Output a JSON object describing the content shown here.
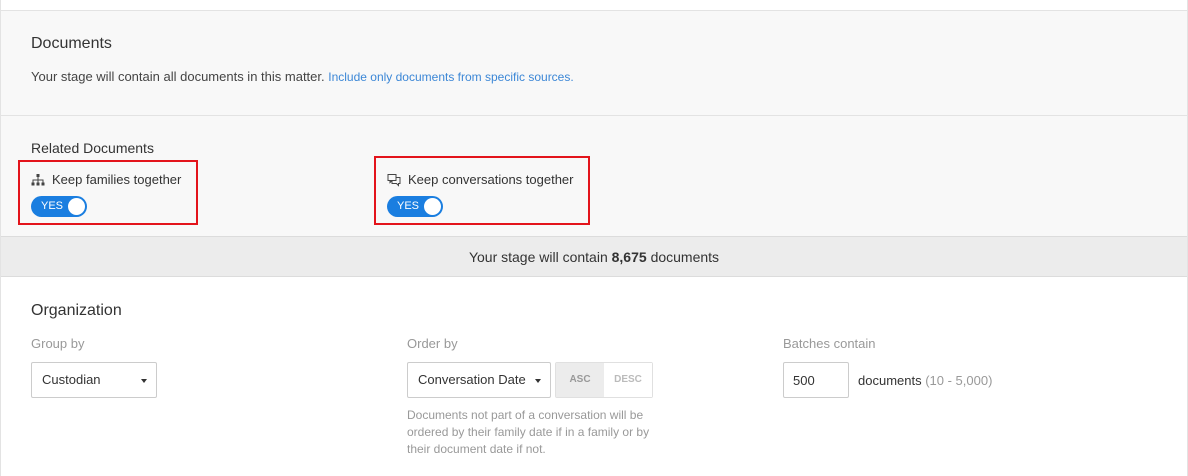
{
  "documents": {
    "title": "Documents",
    "description": "Your stage will contain all documents in this matter.",
    "link": "Include only documents from specific sources."
  },
  "related": {
    "title": "Related Documents",
    "families": {
      "label": "Keep families together",
      "toggle": "YES",
      "icon": "hierarchy-icon"
    },
    "conversations": {
      "label": "Keep conversations together",
      "toggle": "YES",
      "icon": "conversation-icon"
    }
  },
  "summary": {
    "prefix": "Your stage will contain",
    "count": "8,675",
    "suffix": "documents"
  },
  "organization": {
    "title": "Organization",
    "group_by": {
      "label": "Group by",
      "value": "Custodian"
    },
    "order_by": {
      "label": "Order by",
      "value": "Conversation Date",
      "asc": "ASC",
      "desc": "DESC",
      "note": "Documents not part of a conversation will be ordered by their family date if in a family or by their document date if not."
    },
    "batches": {
      "label": "Batches contain",
      "value": "500",
      "unit": "documents",
      "range": "(10 - 5,000)"
    }
  },
  "colors": {
    "accent": "#1a7ee0",
    "link": "#3c87d6",
    "highlight": "#e3141b"
  }
}
